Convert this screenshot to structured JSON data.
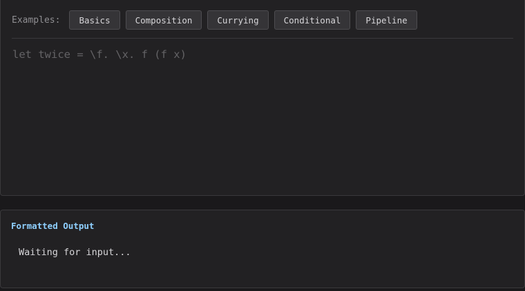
{
  "examples": {
    "label": "Examples:",
    "buttons": [
      "Basics",
      "Composition",
      "Currying",
      "Conditional",
      "Pipeline"
    ]
  },
  "editor": {
    "placeholder": "let twice = \\f. \\x. f (f x)",
    "value": ""
  },
  "output": {
    "title": "Formatted Output",
    "status": "Waiting for input..."
  },
  "colors": {
    "accent": "#8fd0ff",
    "background": "#1a191b",
    "panel": "#222123"
  }
}
